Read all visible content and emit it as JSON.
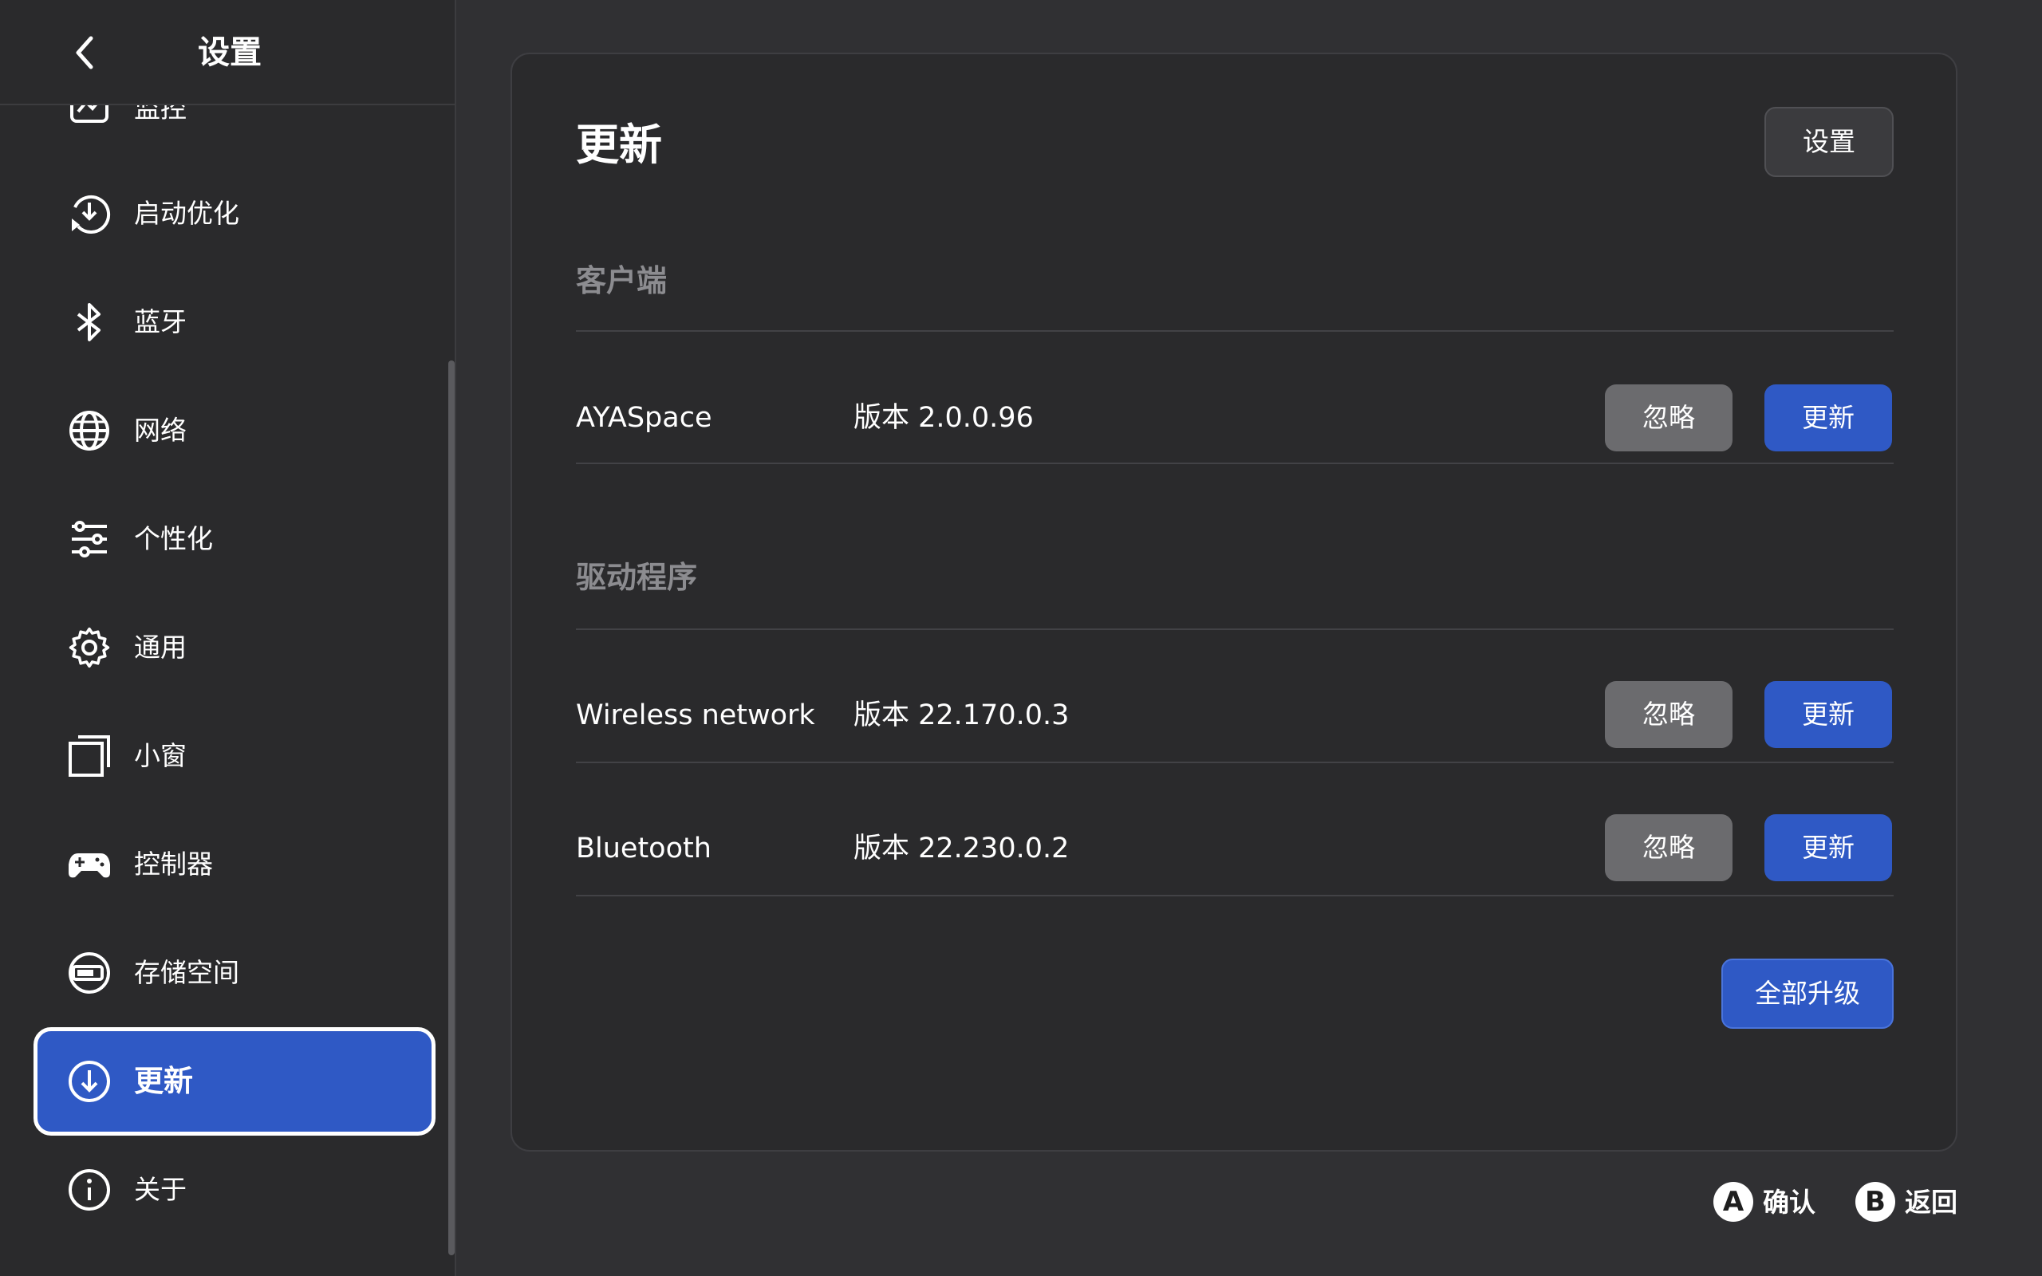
{
  "sidebar": {
    "title": "设置",
    "partial_item_label": "监控",
    "items": [
      {
        "label": "启动优化",
        "icon": "boot-optimize-icon"
      },
      {
        "label": "蓝牙",
        "icon": "bluetooth-icon"
      },
      {
        "label": "网络",
        "icon": "globe-icon"
      },
      {
        "label": "个性化",
        "icon": "sliders-icon"
      },
      {
        "label": "通用",
        "icon": "gear-icon"
      },
      {
        "label": "小窗",
        "icon": "window-icon"
      },
      {
        "label": "控制器",
        "icon": "gamepad-icon"
      },
      {
        "label": "存储空间",
        "icon": "storage-icon"
      },
      {
        "label": "更新",
        "icon": "download-icon",
        "active": true
      },
      {
        "label": "关于",
        "icon": "info-icon"
      }
    ]
  },
  "main": {
    "title": "更新",
    "settings_button": "设置",
    "sections": [
      {
        "title": "客户端",
        "rows": [
          {
            "name": "AYASpace",
            "version": "版本 2.0.0.96",
            "ignore": "忽略",
            "update": "更新"
          }
        ]
      },
      {
        "title": "驱动程序",
        "rows": [
          {
            "name": "Wireless network",
            "version": "版本 22.170.0.3",
            "ignore": "忽略",
            "update": "更新"
          },
          {
            "name": "Bluetooth",
            "version": "版本 22.230.0.2",
            "ignore": "忽略",
            "update": "更新"
          }
        ]
      }
    ],
    "upgrade_all_button": "全部升级"
  },
  "footer": {
    "confirm": {
      "key": "A",
      "label": "确认"
    },
    "back": {
      "key": "B",
      "label": "返回"
    }
  },
  "colors": {
    "accent": "#2f59c5",
    "background": "#303033",
    "panel": "#2a2a2c",
    "ignore_button": "#6b6b6e"
  }
}
